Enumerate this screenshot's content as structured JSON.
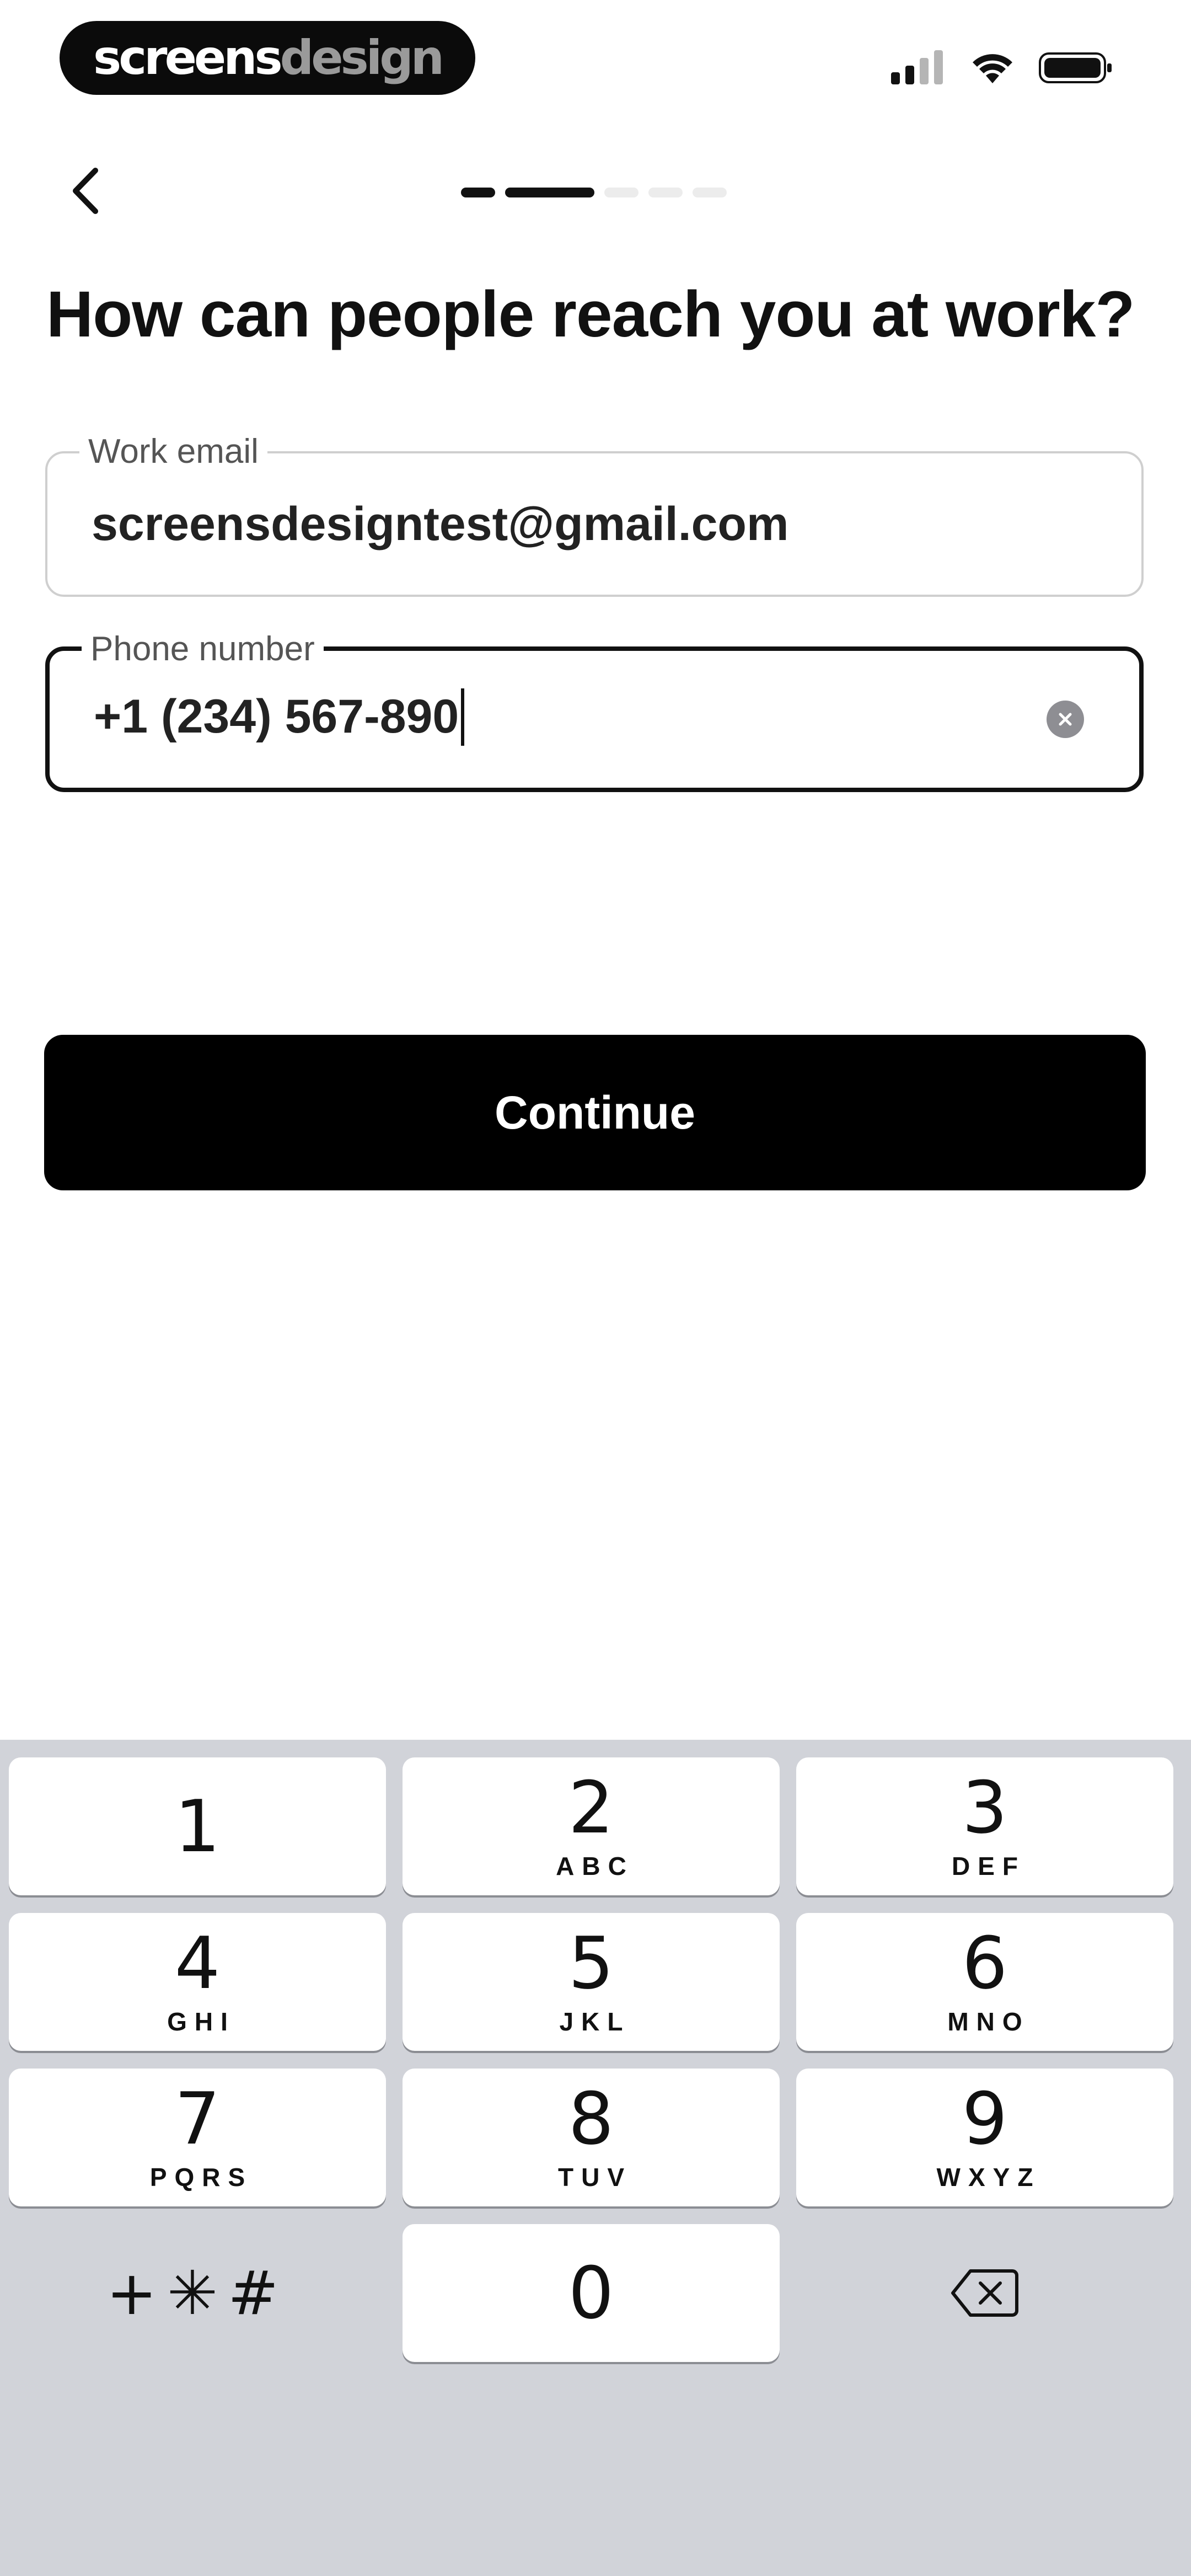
{
  "status_bar": {
    "brand_part1": "screens",
    "brand_part2": "design",
    "icons": [
      "cellular-signal-icon",
      "wifi-icon",
      "battery-icon"
    ]
  },
  "nav": {
    "back_icon": "chevron-left-icon",
    "progress_total_steps": 5,
    "progress_current_step": 2
  },
  "title": "How can people reach you at work?",
  "fields": {
    "email": {
      "label": "Work email",
      "value": "screensdesigntest@gmail.com"
    },
    "phone": {
      "label": "Phone number",
      "value": "+1 (234) 567-890",
      "clear_icon": "clear-circle-icon"
    }
  },
  "continue_label": "Continue",
  "keypad": {
    "keys": [
      {
        "num": "1",
        "letters": ""
      },
      {
        "num": "2",
        "letters": "ABC"
      },
      {
        "num": "3",
        "letters": "DEF"
      },
      {
        "num": "4",
        "letters": "GHI"
      },
      {
        "num": "5",
        "letters": "JKL"
      },
      {
        "num": "6",
        "letters": "MNO"
      },
      {
        "num": "7",
        "letters": "PQRS"
      },
      {
        "num": "8",
        "letters": "TUV"
      },
      {
        "num": "9",
        "letters": "WXYZ"
      },
      {
        "num": "0",
        "letters": ""
      }
    ],
    "symbols_label": "+✳#",
    "delete_icon": "backspace-icon"
  },
  "colors": {
    "accent": "#000000",
    "keypad_background": "#d1d3d9",
    "focused_border": "#111111",
    "idle_border": "#cfcfcf"
  }
}
